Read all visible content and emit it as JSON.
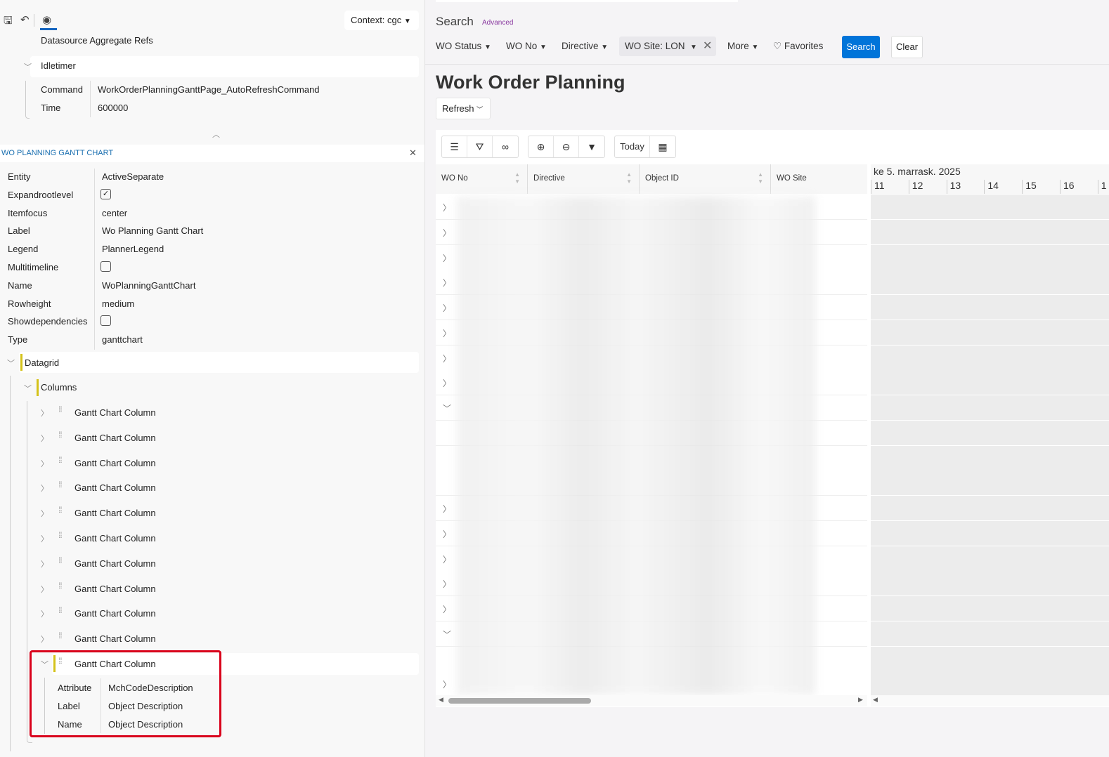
{
  "left": {
    "context": "Context: cgc",
    "datasource_label": "Datasource Aggregate Refs",
    "idletimer": {
      "label": "Idletimer",
      "props": [
        {
          "k": "Command",
          "v": "WorkOrderPlanningGanttPage_AutoRefreshCommand"
        },
        {
          "k": "Time",
          "v": "600000"
        }
      ]
    },
    "section_title": "WO PLANNING GANTT CHART",
    "props": [
      {
        "k": "Entity",
        "v": "ActiveSeparate"
      },
      {
        "k": "Expandrootlevel",
        "checkbox": true
      },
      {
        "k": "Itemfocus",
        "v": "center"
      },
      {
        "k": "Label",
        "v": "Wo Planning Gantt Chart"
      },
      {
        "k": "Legend",
        "v": "PlannerLegend"
      },
      {
        "k": "Multitimeline",
        "checkbox": false
      },
      {
        "k": "Name",
        "v": "WoPlanningGanttChart"
      },
      {
        "k": "Rowheight",
        "v": "medium"
      },
      {
        "k": "Showdependencies",
        "checkbox": false
      },
      {
        "k": "Type",
        "v": "ganttchart"
      }
    ],
    "datagrid": "Datagrid",
    "columns": "Columns",
    "column_item": "Gantt Chart Column",
    "expanded_column": {
      "label": "Gantt Chart Column",
      "props": [
        {
          "k": "Attribute",
          "v": "MchCodeDescription"
        },
        {
          "k": "Label",
          "v": "Object Description"
        },
        {
          "k": "Name",
          "v": "Object Description"
        }
      ]
    },
    "highlight_color": "#d9001b"
  },
  "search": {
    "title": "Search",
    "advanced": "Advanced",
    "filters": [
      "WO Status",
      "WO No",
      "Directive"
    ],
    "site_filter": "WO Site: LON",
    "more": "More",
    "favorites": "Favorites",
    "search_btn": "Search",
    "clear_btn": "Clear",
    "accent": "#0074d9"
  },
  "page": {
    "title": "Work Order Planning",
    "refresh": "Refresh"
  },
  "gantt": {
    "today": "Today",
    "columns": [
      "WO No",
      "Directive",
      "Object ID",
      "WO Site"
    ],
    "month": "ke 5. marrask. 2025",
    "days": [
      "11",
      "12",
      "13",
      "14",
      "15",
      "16",
      "1"
    ]
  }
}
